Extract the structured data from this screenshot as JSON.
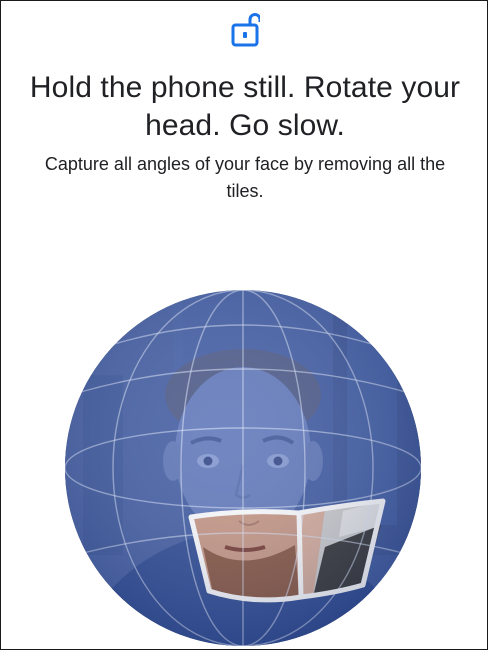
{
  "header": {
    "icon": "lock-open-icon",
    "accent_color": "#1a73e8"
  },
  "instructions": {
    "title": "Hold the phone still. Rotate your head. Go slow.",
    "subtitle": "Capture all angles of your face by removing all the tiles."
  },
  "capture": {
    "overlay_color": "#3f63b8",
    "tiles_removed": 2
  }
}
